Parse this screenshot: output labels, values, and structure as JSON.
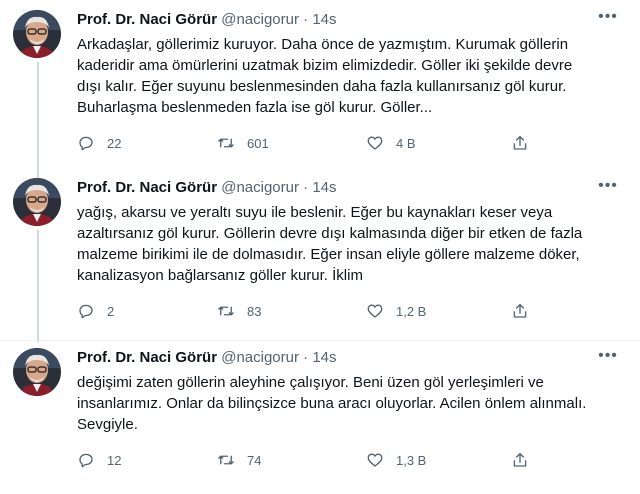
{
  "author": {
    "name": "Prof. Dr. Naci Görür",
    "handle": "@nacigorur",
    "separator": "·"
  },
  "icons": {
    "reply": "reply-icon",
    "retweet": "retweet-icon",
    "like": "heart-icon",
    "share": "share-icon",
    "more": "more-options-icon"
  },
  "colors": {
    "secondary_text": "#536471",
    "thread_line": "#cfd9de"
  },
  "more_glyph": "•••",
  "tweets": [
    {
      "time": "14s",
      "text": "Arkadaşlar, göllerimiz kuruyor. Daha önce de yazmıştım. Kurumak göllerin\nkaderidir ama ömürlerini uzatmak bizim elimizdedir. Göller iki şekilde devre\ndışı kalır. Eğer suyunu beslenmesinden daha fazla kullanırsanız göl kurur.\nBuharlaşma beslenmeden fazla ise göl kurur. Göller...",
      "replies": "22",
      "retweets": "601",
      "likes": "4 B"
    },
    {
      "time": "14s",
      "text": "yağış, akarsu ve yeraltı suyu ile beslenir. Eğer bu kaynakları keser veya\nazaltırsanız göl kurur. Göllerin devre dışı kalmasında diğer bir etken de fazla\nmalzeme birikimi ile de dolmasıdır. Eğer insan eliyle göllere malzeme döker,\nkanalizasyon bağlarsanız göller kurur. İklim",
      "replies": "2",
      "retweets": "83",
      "likes": "1,2 B"
    },
    {
      "time": "14s",
      "text": "değişimi zaten göllerin aleyhine çalışıyor. Beni üzen göl yerleşimleri ve\ninsanlarımız. Onlar da bilinçsizce buna aracı oluyorlar. Acilen önlem alınmalı.\nSevgiyle.",
      "replies": "12",
      "retweets": "74",
      "likes": "1,3 B"
    }
  ]
}
